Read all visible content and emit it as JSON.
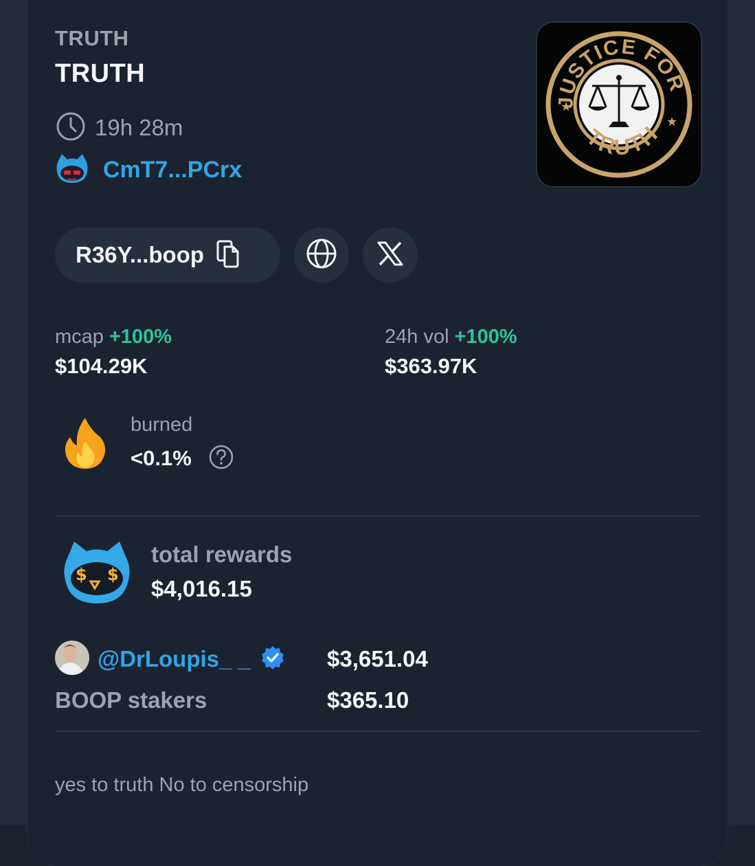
{
  "token": {
    "ticker": "TRUTH",
    "name": "TRUTH",
    "age": "19h 28m",
    "creator": "CmT7...PCrx",
    "logo_text_top": "JUSTICE FOR",
    "logo_text_bottom": "TRUTH"
  },
  "links": {
    "address": "R36Y...boop",
    "copy_icon": "copy-icon",
    "website_icon": "globe-icon",
    "x_icon": "x-logo-icon"
  },
  "stats": {
    "mcap_label": "mcap",
    "mcap_change": "+100%",
    "mcap_value": "$104.29K",
    "vol_label": "24h vol",
    "vol_change": "+100%",
    "vol_value": "$363.97K",
    "burned_label": "burned",
    "burned_value": "<0.1%"
  },
  "rewards": {
    "label": "total rewards",
    "value": "$4,016.15",
    "recipients": [
      {
        "name": "@DrLoupis_ _",
        "amount": "$3,651.04",
        "verified": true
      },
      {
        "name": "BOOP stakers",
        "amount": "$365.10"
      }
    ]
  },
  "description": "yes to truth No to censorship",
  "colors": {
    "background": "#1b2330",
    "accent_blue": "#2fa6e6",
    "positive_green": "#2fc39a",
    "muted_text": "#9aa3ae",
    "logo_gold": "#c9a46a"
  }
}
